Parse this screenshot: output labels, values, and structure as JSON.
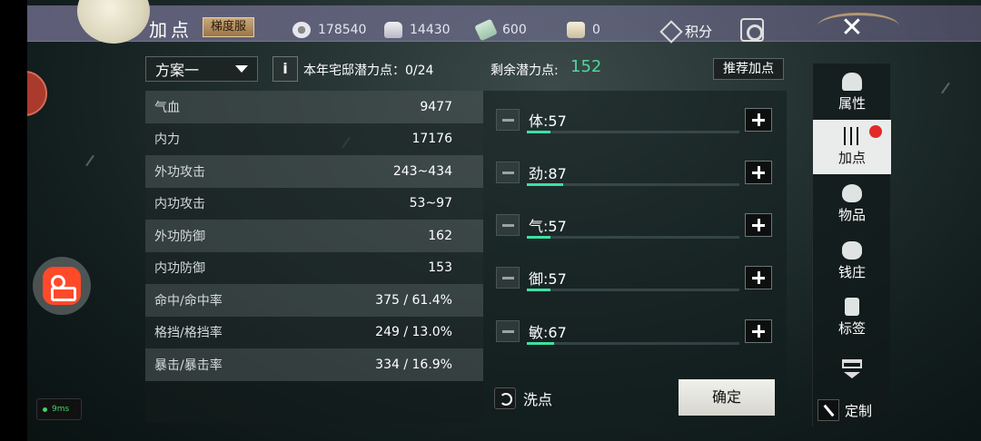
{
  "header": {
    "title": "加点",
    "server_badge": "梯度服",
    "currencies": [
      {
        "icon": "coin-icon",
        "value": "178540"
      },
      {
        "icon": "silver-ingot-icon",
        "value": "14430"
      },
      {
        "icon": "jade-icon",
        "value": "600"
      },
      {
        "icon": "ticket-icon",
        "value": "0"
      }
    ],
    "points_label": "积分"
  },
  "plan": {
    "selected": "方案一",
    "info_glyph": "i",
    "house_points": "本年宅邸潜力点：0/24"
  },
  "stats": [
    {
      "name": "气血",
      "value": "9477"
    },
    {
      "name": "内力",
      "value": "17176"
    },
    {
      "name": "外功攻击",
      "value": "243~434"
    },
    {
      "name": "内功攻击",
      "value": "53~97"
    },
    {
      "name": "外功防御",
      "value": "162"
    },
    {
      "name": "内功防御",
      "value": "153"
    },
    {
      "name": "命中/命中率",
      "value": "375 / 61.4%"
    },
    {
      "name": "格挡/格挡率",
      "value": "249 / 13.0%"
    },
    {
      "name": "暴击/暴击率",
      "value": "334 / 16.9%"
    }
  ],
  "potential": {
    "remaining_label": "剩余潜力点:",
    "remaining_value": "152",
    "recommend_label": "推荐加点"
  },
  "attributes": [
    {
      "label": "体:57",
      "fill": 0.11
    },
    {
      "label": "劲:87",
      "fill": 0.17
    },
    {
      "label": "气:57",
      "fill": 0.11
    },
    {
      "label": "御:57",
      "fill": 0.11
    },
    {
      "label": "敏:67",
      "fill": 0.13
    }
  ],
  "actions": {
    "wash_label": "洗点",
    "confirm_label": "确定"
  },
  "nav": [
    {
      "label": "属性",
      "icon": "hat-icon"
    },
    {
      "label": "加点",
      "icon": "sliders-icon",
      "active": true
    },
    {
      "label": "物品",
      "icon": "bag-icon"
    },
    {
      "label": "钱庄",
      "icon": "money-pouch-icon"
    },
    {
      "label": "标签",
      "icon": "tag-icon"
    }
  ],
  "customize_label": "定制",
  "fps_text": "9ms",
  "colors": {
    "accent_green": "#4fd79a",
    "bar_fill": "#3fe0a4",
    "notification_red": "#e02a2a"
  }
}
